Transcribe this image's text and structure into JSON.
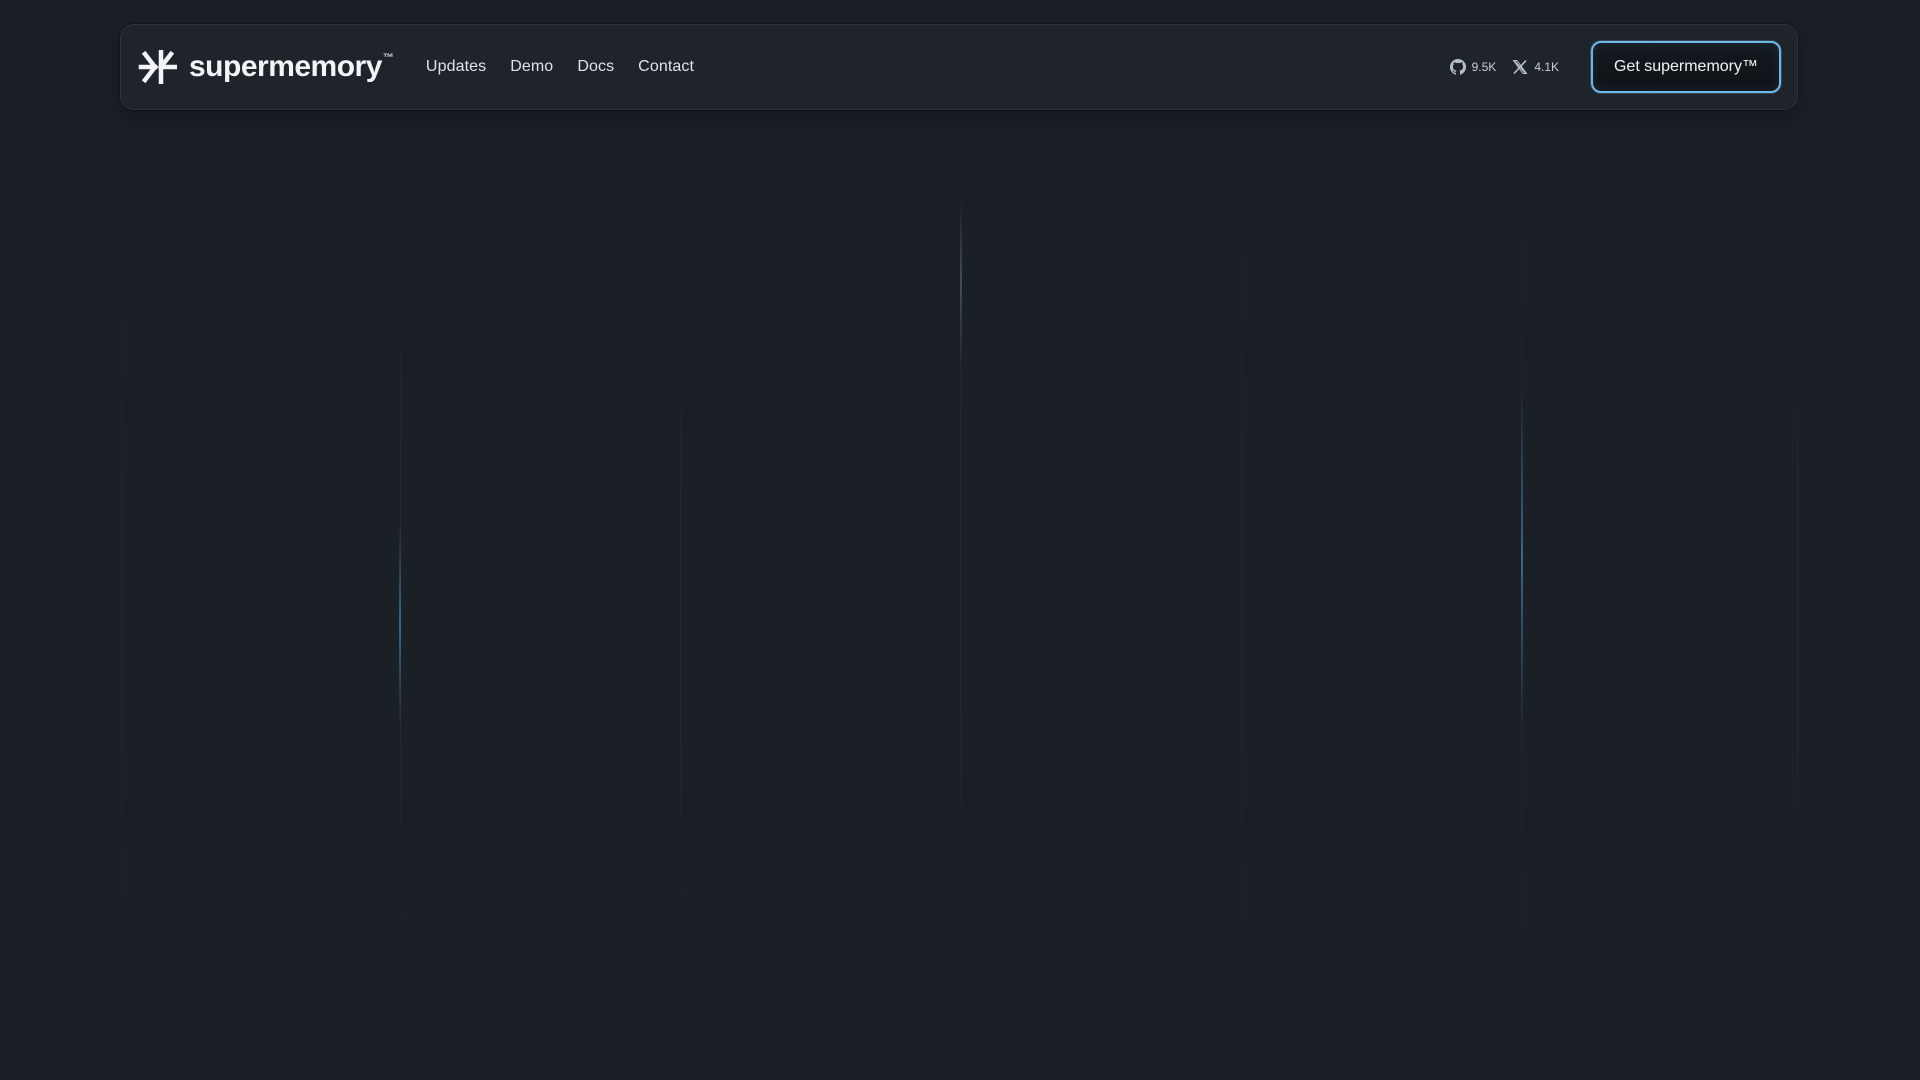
{
  "brand": {
    "name": "supermemory",
    "tm": "™",
    "logo_icon": "supermemory-logo-icon"
  },
  "nav": {
    "links": [
      {
        "label": "Updates"
      },
      {
        "label": "Demo"
      },
      {
        "label": "Docs"
      },
      {
        "label": "Contact"
      }
    ]
  },
  "stats": {
    "github": {
      "icon": "github-icon",
      "value": "9.5K"
    },
    "x": {
      "icon": "x-icon",
      "value": "4.1K"
    }
  },
  "cta": {
    "label": "Get supermemory™"
  },
  "colors": {
    "background": "#1b1f26",
    "navbar": "#1f242b",
    "accent": "#6fb7e9"
  }
}
